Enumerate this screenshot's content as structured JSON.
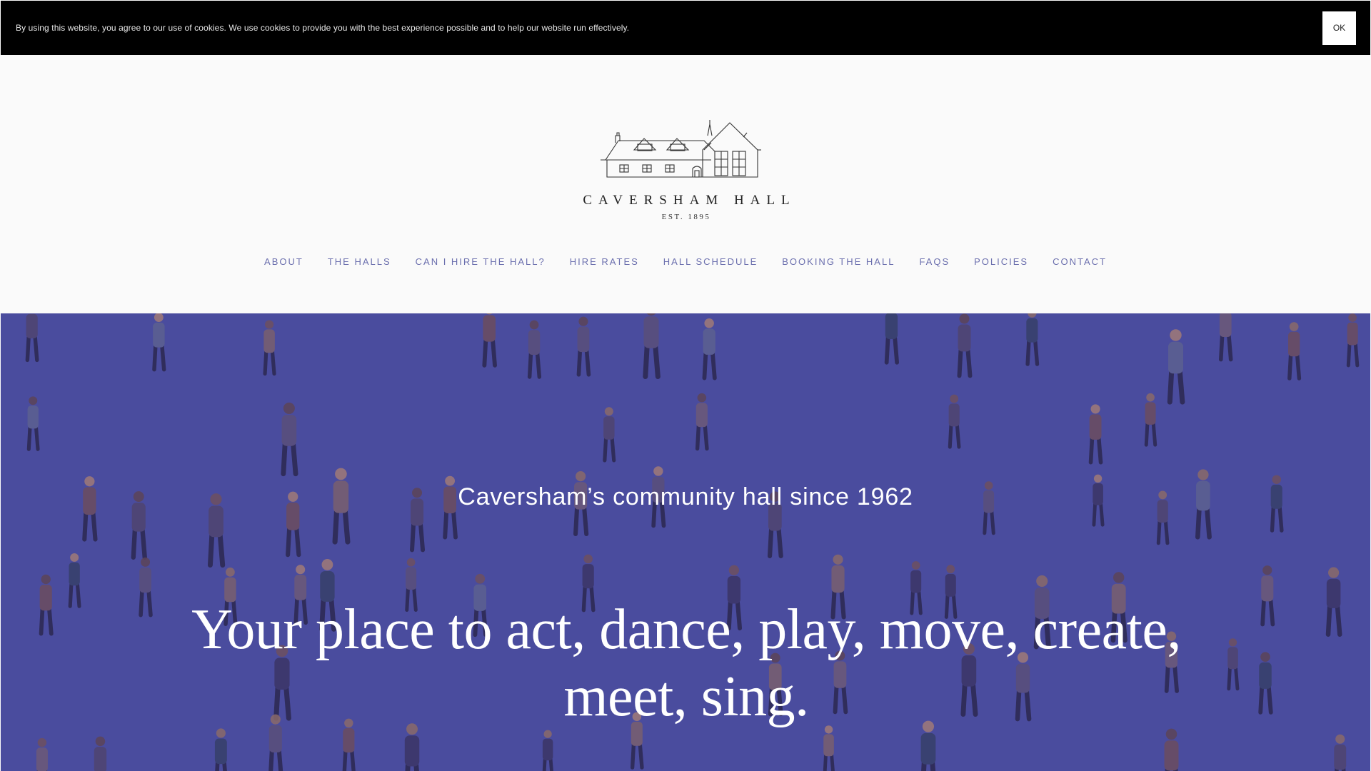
{
  "cookie_bar": {
    "text": "By using this website, you agree to our use of cookies. We use cookies to provide you with the best experience possible and to help our website run effectively.",
    "ok_label": "OK"
  },
  "logo": {
    "name": "CAVERSHAM HALL",
    "established": "EST. 1895"
  },
  "nav": {
    "items": [
      {
        "label": "ABOUT"
      },
      {
        "label": "THE HALLS"
      },
      {
        "label": "CAN I HIRE THE HALL?"
      },
      {
        "label": "HIRE RATES"
      },
      {
        "label": "HALL SCHEDULE"
      },
      {
        "label": "BOOKING THE HALL"
      },
      {
        "label": "FAQS"
      },
      {
        "label": "POLICIES"
      },
      {
        "label": "CONTACT"
      }
    ]
  },
  "hero": {
    "tagline": "Caversham’s community hall since 1962",
    "headline_line1": "Your place to act, dance, play, move, create,",
    "headline_line2": "meet, sing."
  },
  "colors": {
    "hero_bg": "#4a4c9e",
    "nav_text": "#6b6fae",
    "cookie_bg": "#000000"
  }
}
